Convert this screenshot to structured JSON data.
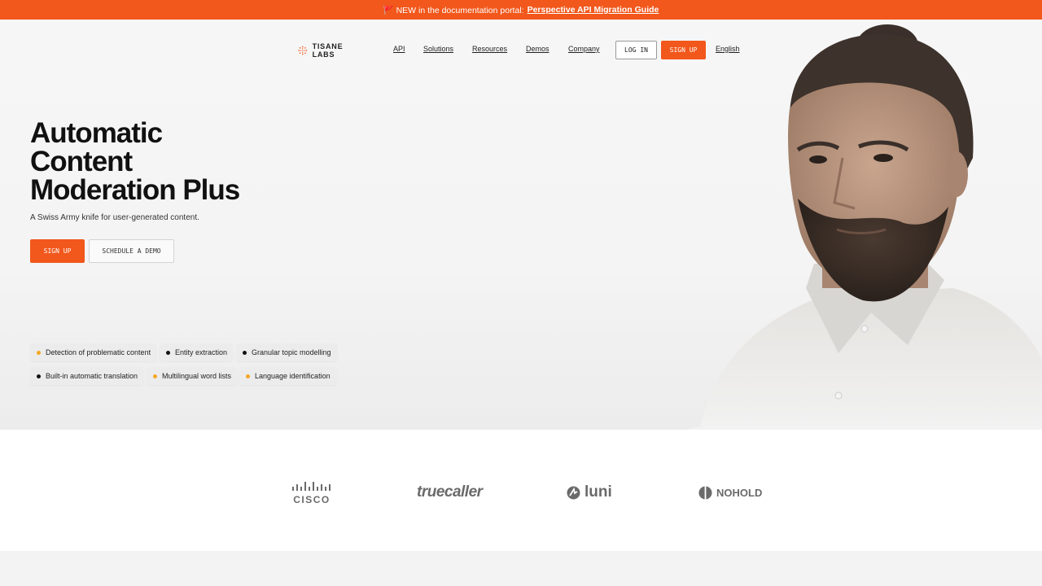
{
  "banner": {
    "prefix": "🚩 NEW in the documentation portal:",
    "link": "Perspective API Migration Guide"
  },
  "nav": {
    "brand": "TISANE LABS",
    "links": [
      "API",
      "Solutions",
      "Resources",
      "Demos",
      "Company"
    ],
    "login": "LOG IN",
    "signup": "SIGN UP",
    "language": "English"
  },
  "hero": {
    "headline": [
      "Automatic",
      "Content",
      "Moderation Plus"
    ],
    "subhead": "A Swiss Army knife for user-generated content.",
    "cta_primary": "SIGN UP",
    "cta_secondary": "SCHEDULE A DEMO"
  },
  "features": [
    {
      "label": "Detection of problematic content",
      "dot": "#f5a623"
    },
    {
      "label": "Entity extraction",
      "dot": "#111111"
    },
    {
      "label": "Granular topic modelling",
      "dot": "#111111"
    },
    {
      "label": "Built-in automatic translation",
      "dot": "#111111"
    },
    {
      "label": "Multilingual word lists",
      "dot": "#f5a623"
    },
    {
      "label": "Language identification",
      "dot": "#f5a623"
    }
  ],
  "clients": [
    "CISCO",
    "truecaller",
    "luni",
    "NOHOLD"
  ],
  "colors": {
    "accent": "#f2571b",
    "hero_bg": "#f5f5f5",
    "client_logo": "#6a6a6a"
  },
  "portrait_icon": "bearded-man-portrait"
}
